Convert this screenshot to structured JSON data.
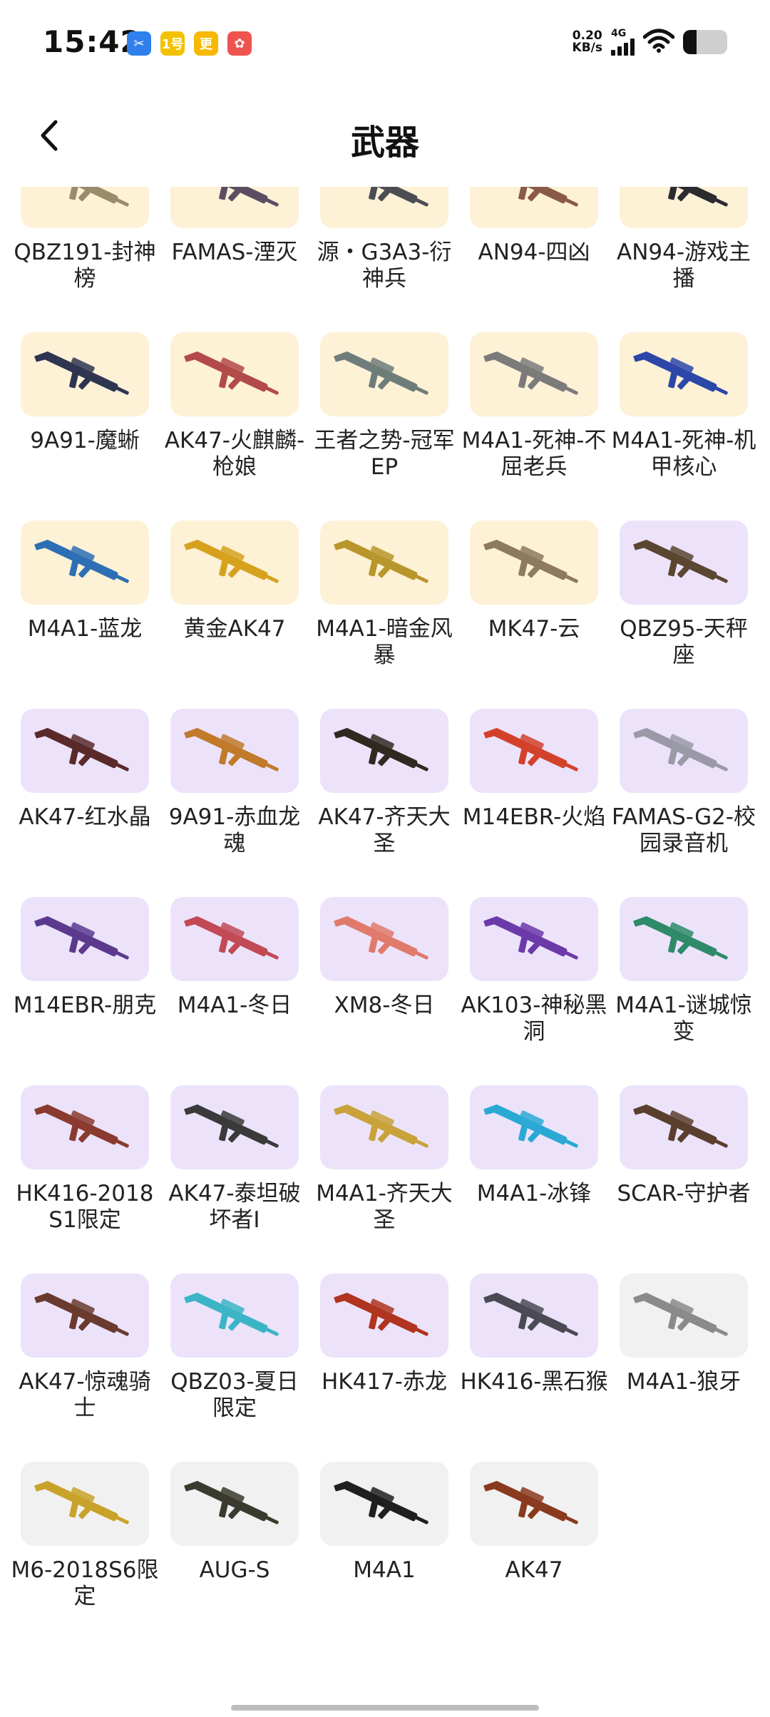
{
  "status_bar": {
    "time": "15:42",
    "net_speed_value": "0.20",
    "net_speed_unit": "KB/s",
    "network_type": "4G",
    "app_icons": [
      {
        "name": "app-icon-blue",
        "glyph": "✂",
        "color": "#2f80ed"
      },
      {
        "name": "app-icon-yellow",
        "glyph": "1号",
        "color": "#f2c200"
      },
      {
        "name": "app-icon-yellow-2",
        "glyph": "更",
        "color": "#f6b900"
      },
      {
        "name": "app-icon-red",
        "glyph": "✿",
        "color": "#ef5350"
      }
    ],
    "battery_percent": 30
  },
  "header": {
    "title": "武器"
  },
  "colors": {
    "tier_gold": "#fdf1d6",
    "tier_purple": "#ece3fb",
    "tier_gray": "#f1f1f1"
  },
  "weapons": [
    {
      "name": "QBZ191-封神榜",
      "tier": "gold",
      "color": "#9a8c6a",
      "partial": true
    },
    {
      "name": "FAMAS-湮灭",
      "tier": "gold",
      "color": "#5b4e63",
      "partial": true
    },
    {
      "name": "源・G3A3-衍神兵",
      "tier": "gold",
      "color": "#4c4d52",
      "partial": true
    },
    {
      "name": "AN94-四凶",
      "tier": "gold",
      "color": "#8a5a46",
      "partial": true
    },
    {
      "name": "AN94-游戏主播",
      "tier": "gold",
      "color": "#2c2c30",
      "partial": true
    },
    {
      "name": "9A91-魔蜥",
      "tier": "gold",
      "color": "#2d3550"
    },
    {
      "name": "AK47-火麒麟-枪娘",
      "tier": "gold",
      "color": "#b24a4a"
    },
    {
      "name": "王者之势-冠军EP",
      "tier": "gold",
      "color": "#6f7d7a"
    },
    {
      "name": "M4A1-死神-不屈老兵",
      "tier": "gold",
      "color": "#7b7b7b"
    },
    {
      "name": "M4A1-死神-机甲核心",
      "tier": "gold",
      "color": "#2c47a8"
    },
    {
      "name": "M4A1-蓝龙",
      "tier": "gold",
      "color": "#2d6fb5"
    },
    {
      "name": "黄金AK47",
      "tier": "gold",
      "color": "#d6a21e"
    },
    {
      "name": "M4A1-暗金风暴",
      "tier": "gold",
      "color": "#b8962c"
    },
    {
      "name": "MK47-云",
      "tier": "gold",
      "color": "#8d7a5f"
    },
    {
      "name": "QBZ95-天秤座",
      "tier": "purple",
      "color": "#5a4631"
    },
    {
      "name": "AK47-红水晶",
      "tier": "purple",
      "color": "#5a2a2a"
    },
    {
      "name": "9A91-赤血龙魂",
      "tier": "purple",
      "color": "#c07a2a"
    },
    {
      "name": "AK47-齐天大圣",
      "tier": "purple",
      "color": "#2f2a20"
    },
    {
      "name": "M14EBR-火焰",
      "tier": "purple",
      "color": "#d4412b"
    },
    {
      "name": "FAMAS-G2-校园录音机",
      "tier": "purple",
      "color": "#9a9aa6"
    },
    {
      "name": "M14EBR-朋克",
      "tier": "purple",
      "color": "#5b3a8e"
    },
    {
      "name": "M4A1-冬日",
      "tier": "purple",
      "color": "#c24a56"
    },
    {
      "name": "XM8-冬日",
      "tier": "purple",
      "color": "#e07a6a"
    },
    {
      "name": "AK103-神秘黑洞",
      "tier": "purple",
      "color": "#6c3aa8"
    },
    {
      "name": "M4A1-谜城惊变",
      "tier": "purple",
      "color": "#2f8a6a"
    },
    {
      "name": "HK416-2018S1限定",
      "tier": "purple",
      "color": "#8a3a2e"
    },
    {
      "name": "AK47-泰坦破坏者Ⅰ",
      "tier": "purple",
      "color": "#3a3a3a"
    },
    {
      "name": "M4A1-齐天大圣",
      "tier": "purple",
      "color": "#c9a23a"
    },
    {
      "name": "M4A1-冰锋",
      "tier": "purple",
      "color": "#2aa9d4"
    },
    {
      "name": "SCAR-守护者",
      "tier": "purple",
      "color": "#5a3f2e"
    },
    {
      "name": "AK47-惊魂骑士",
      "tier": "purple",
      "color": "#6a3a2e"
    },
    {
      "name": "QBZ03-夏日限定",
      "tier": "purple",
      "color": "#3bb5c6"
    },
    {
      "name": "HK417-赤龙",
      "tier": "purple",
      "color": "#b0341f"
    },
    {
      "name": "HK416-黑石猴",
      "tier": "purple",
      "color": "#4a4a55"
    },
    {
      "name": "M4A1-狼牙",
      "tier": "gray",
      "color": "#8a8a8a"
    },
    {
      "name": "M6-2018S6限定",
      "tier": "gray",
      "color": "#c9a22a"
    },
    {
      "name": "AUG-S",
      "tier": "gray",
      "color": "#3a3a2e"
    },
    {
      "name": "M4A1",
      "tier": "gray",
      "color": "#1f1f1f"
    },
    {
      "name": "AK47",
      "tier": "gray",
      "color": "#8a3a1e"
    }
  ]
}
